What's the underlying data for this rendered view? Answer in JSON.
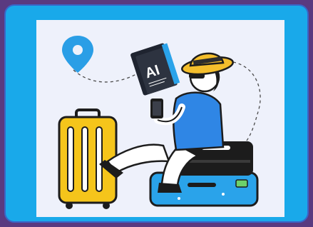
{
  "illustration": {
    "book_text": "AI",
    "colors": {
      "outer_background": "#5a3a80",
      "frame": "#19a9ea",
      "canvas": "#eef1fb",
      "pin": "#2a9ee6",
      "suitcase_yellow": "#f5c51b",
      "shirt_blue": "#2f86e5",
      "hat_yellow": "#f4be2c",
      "suitcase_blue": "#2aa3ea",
      "suitcase_black": "#1c1c1c"
    },
    "icons": [
      "location-pin-icon",
      "ai-book-icon"
    ]
  }
}
